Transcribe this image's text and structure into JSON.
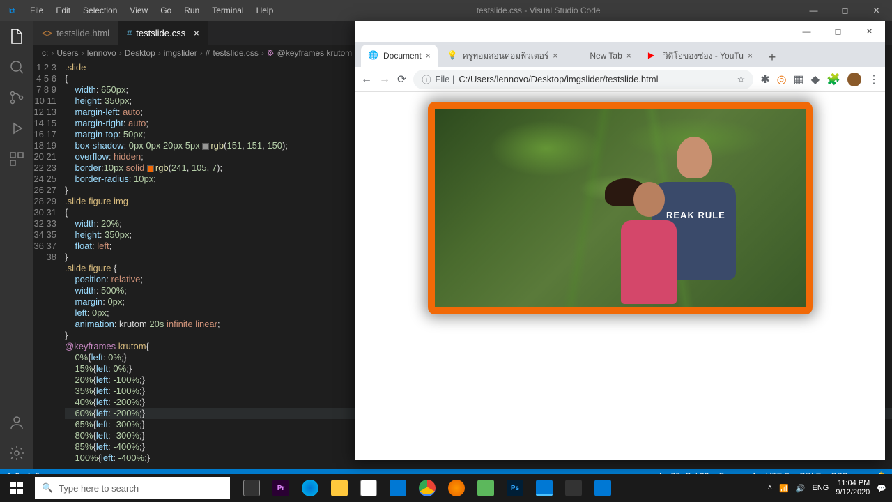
{
  "titlebar": {
    "menus": [
      "File",
      "Edit",
      "Selection",
      "View",
      "Go",
      "Run",
      "Terminal",
      "Help"
    ],
    "title": "testslide.css - Visual Studio Code"
  },
  "tabs": [
    {
      "name": "testslide.html",
      "active": false
    },
    {
      "name": "testslide.css",
      "active": true
    }
  ],
  "breadcrumb": [
    "c:",
    "Users",
    "lennovo",
    "Desktop",
    "imgslider",
    "testslide.css",
    "@keyframes krutom"
  ],
  "code_lines": [
    "1",
    "2",
    "3",
    "4",
    "5",
    "6",
    "7",
    "8",
    "9",
    "10",
    "11",
    "12",
    "13",
    "14",
    "15",
    "16",
    "17",
    "18",
    "19",
    "20",
    "21",
    "22",
    "23",
    "24",
    "25",
    "26",
    "27",
    "28",
    "29",
    "30",
    "31",
    "32",
    "33",
    "34",
    "35",
    "36",
    "37",
    "38"
  ],
  "statusbar": {
    "left": [
      "⊗ 0",
      "⚠ 0"
    ],
    "right": [
      "Ln 32, Col 22",
      "Spaces: 4",
      "UTF-8",
      "CRLF",
      "CSS",
      "☺"
    ]
  },
  "browser": {
    "tabs": [
      {
        "label": "Document",
        "active": true
      },
      {
        "label": "ครูทอมสอนคอมพิวเตอร์",
        "active": false
      },
      {
        "label": "New Tab",
        "active": false
      },
      {
        "label": "วิดีโอของช่อง - YouTu",
        "active": false
      }
    ],
    "url_prefix": "File |",
    "url": "C:/Users/lennovo/Desktop/imgslider/testslide.html"
  },
  "taskbar": {
    "search": "Type here to search",
    "lang": "ENG",
    "time": "11:04 PM",
    "date": "9/12/2020"
  }
}
